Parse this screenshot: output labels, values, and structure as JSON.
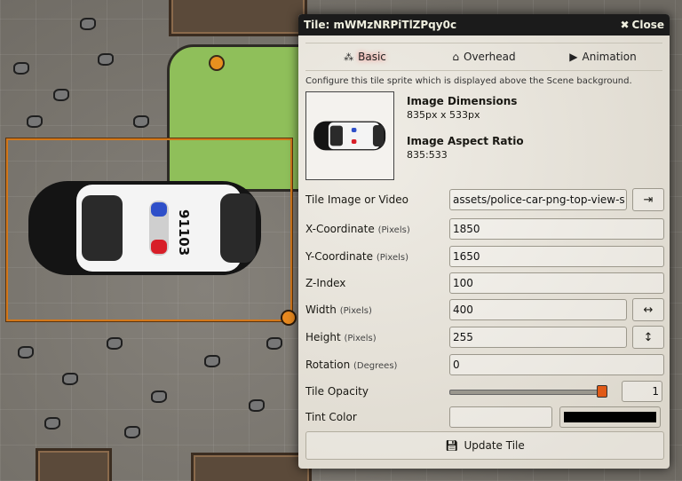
{
  "dialog": {
    "title": "Tile: mWMzNRPiTlZPqy0c",
    "close_label": "Close",
    "tabs": [
      {
        "label": "Basic",
        "icon": "cubes-icon",
        "active": true
      },
      {
        "label": "Overhead",
        "icon": "home-icon",
        "active": false
      },
      {
        "label": "Animation",
        "icon": "play-icon",
        "active": false
      }
    ],
    "hint": "Configure this tile sprite which is displayed above the Scene background.",
    "image_dimensions_title": "Image Dimensions",
    "image_dimensions_value": "835px x 533px",
    "aspect_ratio_title": "Image Aspect Ratio",
    "aspect_ratio_value": "835:533",
    "fields": {
      "image": {
        "label": "Tile Image or Video",
        "value": "assets/police-car-png-top-view-s"
      },
      "x": {
        "label": "X-Coordinate",
        "unit": "(Pixels)",
        "value": "1850"
      },
      "y": {
        "label": "Y-Coordinate",
        "unit": "(Pixels)",
        "value": "1650"
      },
      "z": {
        "label": "Z-Index",
        "value": "100"
      },
      "width": {
        "label": "Width",
        "unit": "(Pixels)",
        "value": "400"
      },
      "height": {
        "label": "Height",
        "unit": "(Pixels)",
        "value": "255"
      },
      "rotation": {
        "label": "Rotation",
        "unit": "(Degrees)",
        "value": "0"
      },
      "opacity": {
        "label": "Tile Opacity",
        "value": "1",
        "fraction": 1.0
      },
      "tint": {
        "label": "Tint Color",
        "value": "",
        "color": "#000000"
      }
    },
    "update_label": "Update Tile"
  },
  "car_number": "91103",
  "colors": {
    "accent": "#d2771a",
    "header_bg": "#1b1b1b",
    "grass": "#8fbf5a"
  }
}
